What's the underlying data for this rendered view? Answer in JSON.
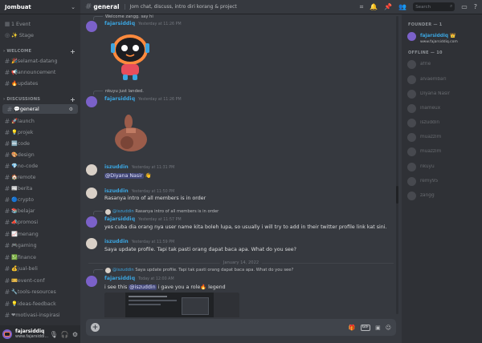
{
  "server": {
    "name": "Jombuat"
  },
  "sidebar": {
    "events": "1 Event",
    "stage": "✨ Stage",
    "categories": {
      "welcome": "WELCOME",
      "discussions": "DISCUSSIONS"
    },
    "welcome_channels": [
      "🎉selamat-datang",
      "📢announcement",
      "🔥updates"
    ],
    "discussion_channels": [
      "💬general",
      "🚀launch",
      "💡projek",
      "🔤code",
      "🎨design",
      "💎no-code",
      "🏠remote",
      "📰berita",
      "🔵crypto",
      "📚belajar",
      "📣promosi",
      "📈menang",
      "🎮gaming",
      "💹finance",
      "💰jual-beli",
      "🎫event-conf",
      "🔧tools-resources",
      "💡ideas-feedback",
      "❤motivasi-inspirasi"
    ]
  },
  "user": {
    "name": "fajarsiddiq",
    "tag": "www.fajarsiddi..."
  },
  "channel": {
    "name": "general",
    "topic": "Jom chat, discuss, intro diri korang & project"
  },
  "search": {
    "placeholder": "Search"
  },
  "messages": {
    "m0_reply": "Welcome zangg. say hi",
    "m1_author": "fajarsiddiq",
    "m1_ts": "Yesterday at 11:26 PM",
    "m2_reply": "nkuyu just landed.",
    "m2_author": "fajarsiddiq",
    "m2_ts": "Yesterday at 11:26 PM",
    "m3_author": "iszuddin",
    "m3_ts": "Yesterday at 11:31 PM",
    "m3_mention": "@Diyana Nasir",
    "m3_emoji": "👋",
    "m4_author": "iszuddin",
    "m4_ts": "Yesterday at 11:50 PM",
    "m4_text": "Rasanya intro of all members is in order",
    "m5_reply_author": "@iszuddin",
    "m5_reply_text": "Rasanya intro of all members is in order",
    "m5_author": "fajarsiddiq",
    "m5_ts": "Yesterday at 11:57 PM",
    "m5_text": "yes cuba dia orang nya user name kita boleh lupa, so usually i will try to add in their twitter profile link kat sini.",
    "m6_author": "iszuddin",
    "m6_ts": "Yesterday at 11:59 PM",
    "m6_text": "Saya update profile. Tapi tak pasti orang dapat baca apa. What do you see?",
    "date_divider": "January 14, 2022",
    "m7_reply_author": "@iszuddin",
    "m7_reply_text": "Saya update profile. Tapi tak pasti orang dapat baca apa. What do you see?",
    "m7_author": "fajarsiddiq",
    "m7_ts": "Today at 12:00 AM",
    "m7_text_a": "i see this",
    "m7_mention": "@iszuddin",
    "m7_text_b": "i gave you a role🔥 legend"
  },
  "members": {
    "founder_header": "FOUNDER — 1",
    "founder": {
      "name": "fajarsiddiq 👑",
      "sub": "www.fajarsiddiq.com"
    },
    "offline_header": "OFFLINE — 10",
    "offline": [
      "afrie",
      "alvaembari",
      "Diyana Nasir",
      "inameux",
      "iszuddin",
      "muazzim",
      "muazzim",
      "nkuyu",
      "remy95",
      "zangg"
    ]
  }
}
